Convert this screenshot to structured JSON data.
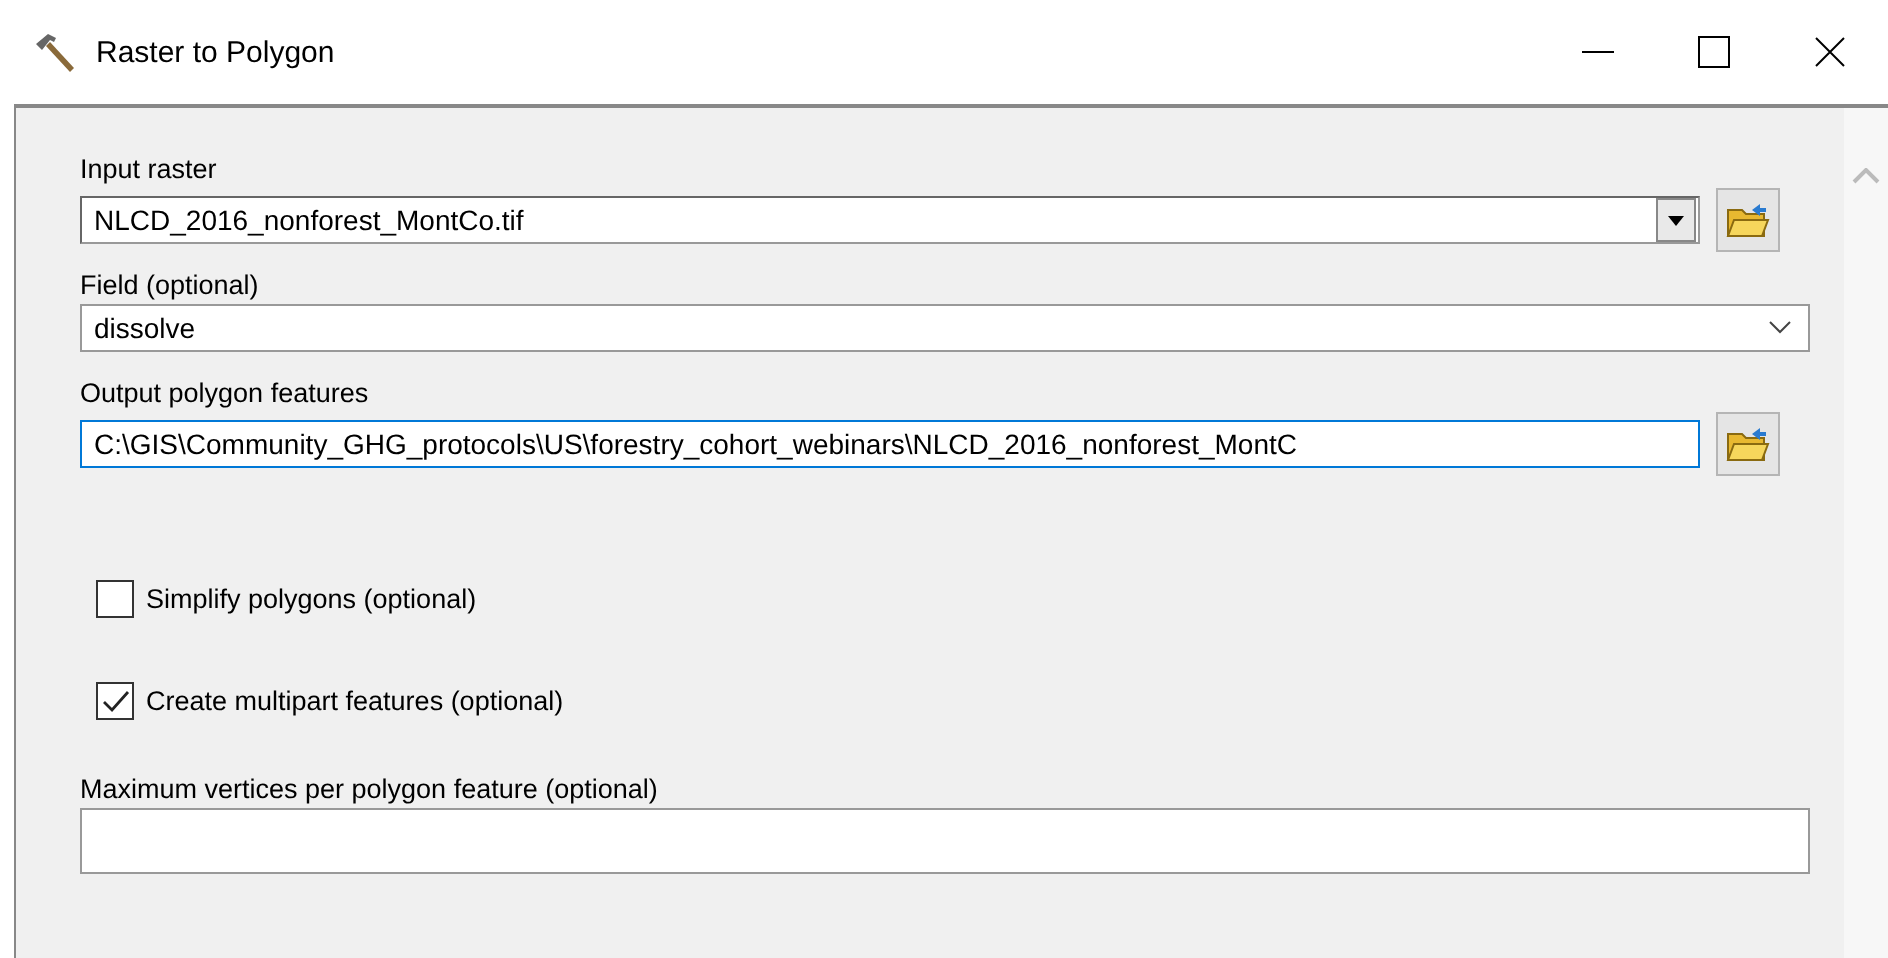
{
  "window": {
    "title": "Raster to Polygon"
  },
  "parameters": [
    {
      "kind": "combo-browse",
      "label": "Input raster",
      "value": "NLCD_2016_nonforest_MontCo.tif"
    },
    {
      "kind": "dropdown",
      "label": "Field (optional)",
      "value": "dissolve"
    },
    {
      "kind": "text-browse",
      "label": "Output polygon features",
      "value": "C:\\GIS\\Community_GHG_protocols\\US\\forestry_cohort_webinars\\NLCD_2016_nonforest_MontC",
      "focused": true
    },
    {
      "kind": "checkbox",
      "label": "Simplify polygons (optional)",
      "checked": false
    },
    {
      "kind": "checkbox",
      "label": "Create multipart features (optional)",
      "checked": true
    },
    {
      "kind": "text",
      "label": "Maximum vertices per polygon feature (optional)"
    }
  ]
}
